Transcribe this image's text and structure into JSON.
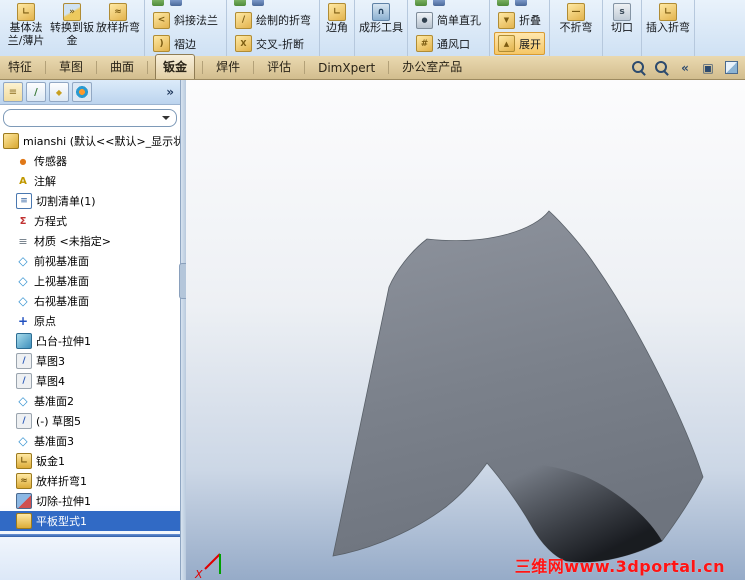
{
  "colors": {
    "selection_blue": "#316ac5",
    "active_button_orange": "#f6c766",
    "tab_strip_tan": "#d8c59a",
    "watermark_red": "#ff1414",
    "shape_gray": "#7d838d"
  },
  "ribbon": {
    "groups": [
      {
        "type": "large",
        "buttons": [
          {
            "name": "base-flange-button",
            "label": "基体法兰/薄片",
            "icon": "base-flange-icon"
          },
          {
            "name": "convert-to-sheet-metal-button",
            "label": "转换到钣金",
            "icon": "convert-to-sheet-metal-icon"
          },
          {
            "name": "lofted-bend-button",
            "label": "放样折弯",
            "icon": "lofted-bend-icon"
          }
        ]
      },
      {
        "type": "small",
        "clipped": true,
        "buttons": [
          {
            "name": "miter-flange-button",
            "label": "斜接法兰",
            "icon": "miter-flange-icon"
          },
          {
            "name": "hem-button",
            "label": "褶边",
            "icon": "hem-icon"
          }
        ]
      },
      {
        "type": "small",
        "clipped": true,
        "buttons": [
          {
            "name": "sketched-bend-button",
            "label": "绘制的折弯",
            "icon": "sketched-bend-icon"
          },
          {
            "name": "cross-break-button",
            "label": "交叉-折断",
            "icon": "cross-break-icon"
          }
        ]
      },
      {
        "type": "large",
        "buttons": [
          {
            "name": "corner-button",
            "label": "边角",
            "icon": "corner-icon"
          }
        ]
      },
      {
        "type": "large",
        "buttons": [
          {
            "name": "forming-tool-button",
            "label": "成形工具",
            "icon": "forming-tool-icon"
          }
        ]
      },
      {
        "type": "small",
        "clipped": true,
        "buttons": [
          {
            "name": "simple-hole-button",
            "label": "简单直孔",
            "icon": "simple-hole-icon"
          },
          {
            "name": "vent-button",
            "label": "通风口",
            "icon": "vent-icon"
          }
        ]
      },
      {
        "type": "small",
        "clipped": true,
        "buttons": [
          {
            "name": "fold-button",
            "label": "折叠",
            "icon": "fold-icon"
          },
          {
            "name": "unfold-button",
            "label": "展开",
            "icon": "unfold-icon",
            "active": true
          }
        ]
      },
      {
        "type": "large",
        "buttons": [
          {
            "name": "no-bends-button",
            "label": "不折弯",
            "icon": "no-bends-icon"
          }
        ]
      },
      {
        "type": "large",
        "buttons": [
          {
            "name": "rip-button",
            "label": "切口",
            "icon": "rip-icon"
          }
        ]
      },
      {
        "type": "large",
        "buttons": [
          {
            "name": "insert-bends-button",
            "label": "插入折弯",
            "icon": "insert-bends-icon"
          }
        ]
      }
    ]
  },
  "tabbar": {
    "tabs": [
      {
        "name": "tab-features",
        "label": "特征"
      },
      {
        "name": "tab-sketch",
        "label": "草图"
      },
      {
        "name": "tab-surfaces",
        "label": "曲面"
      },
      {
        "name": "tab-sheet-metal",
        "label": "钣金",
        "active": true
      },
      {
        "name": "tab-weldments",
        "label": "焊件"
      },
      {
        "name": "tab-evaluate",
        "label": "评估"
      },
      {
        "name": "tab-dimxpert",
        "label": "DimXpert"
      },
      {
        "name": "tab-office-products",
        "label": "办公室产品"
      }
    ],
    "view_icons": [
      {
        "name": "zoom-to-area-icon"
      },
      {
        "name": "zoom-to-fit-icon"
      },
      {
        "name": "previous-view-icon"
      },
      {
        "name": "section-view-icon"
      },
      {
        "name": "view-settings-icon"
      }
    ]
  },
  "panel": {
    "header_icons": [
      {
        "name": "featuremanager-tab-icon"
      },
      {
        "name": "propertymanager-tab-icon"
      },
      {
        "name": "configurationmanager-tab-icon"
      },
      {
        "name": "dimxpertmanager-tab-icon"
      }
    ],
    "chevron": "»",
    "root_label": "mianshi (默认<<默认>_显示状",
    "items": [
      {
        "name": "tree-item-sensors",
        "label": "传感器",
        "icon": "sensors-icon"
      },
      {
        "name": "tree-item-annotations",
        "label": "注解",
        "icon": "annotations-icon"
      },
      {
        "name": "tree-item-cut-list",
        "label": "切割清单(1)",
        "icon": "cutlist-icon"
      },
      {
        "name": "tree-item-equations",
        "label": "方程式",
        "icon": "equations-icon"
      },
      {
        "name": "tree-item-material",
        "label": "材质 <未指定>",
        "icon": "material-icon"
      },
      {
        "name": "tree-item-front-plane",
        "label": "前视基准面",
        "icon": "plane-icon"
      },
      {
        "name": "tree-item-top-plane",
        "label": "上视基准面",
        "icon": "plane-icon"
      },
      {
        "name": "tree-item-right-plane",
        "label": "右视基准面",
        "icon": "plane-icon"
      },
      {
        "name": "tree-item-origin",
        "label": "原点",
        "icon": "origin-icon"
      },
      {
        "name": "tree-item-boss-extrude1",
        "label": "凸台-拉伸1",
        "icon": "boss-extrude-icon"
      },
      {
        "name": "tree-item-sketch3",
        "label": "草图3",
        "icon": "sketch-icon"
      },
      {
        "name": "tree-item-sketch4",
        "label": "草图4",
        "icon": "sketch-icon"
      },
      {
        "name": "tree-item-plane2",
        "label": "基准面2",
        "icon": "plane-icon"
      },
      {
        "name": "tree-item-sketch5",
        "label": "(-) 草图5",
        "icon": "sketch-icon"
      },
      {
        "name": "tree-item-plane3",
        "label": "基准面3",
        "icon": "plane-icon"
      },
      {
        "name": "tree-item-sheet-metal1",
        "label": "钣金1",
        "icon": "sheet-metal-icon"
      },
      {
        "name": "tree-item-lofted-bend1",
        "label": "放样折弯1",
        "icon": "lofted-bend-feature-icon"
      },
      {
        "name": "tree-item-cut-extrude1",
        "label": "切除-拉伸1",
        "icon": "cut-extrude-icon"
      },
      {
        "name": "tree-item-flat-pattern1",
        "label": "平板型式1",
        "icon": "flat-pattern-icon",
        "selected": true
      }
    ]
  },
  "viewport": {
    "watermark": "三维网www.3dportal.cn",
    "axis_x_label": "X"
  }
}
